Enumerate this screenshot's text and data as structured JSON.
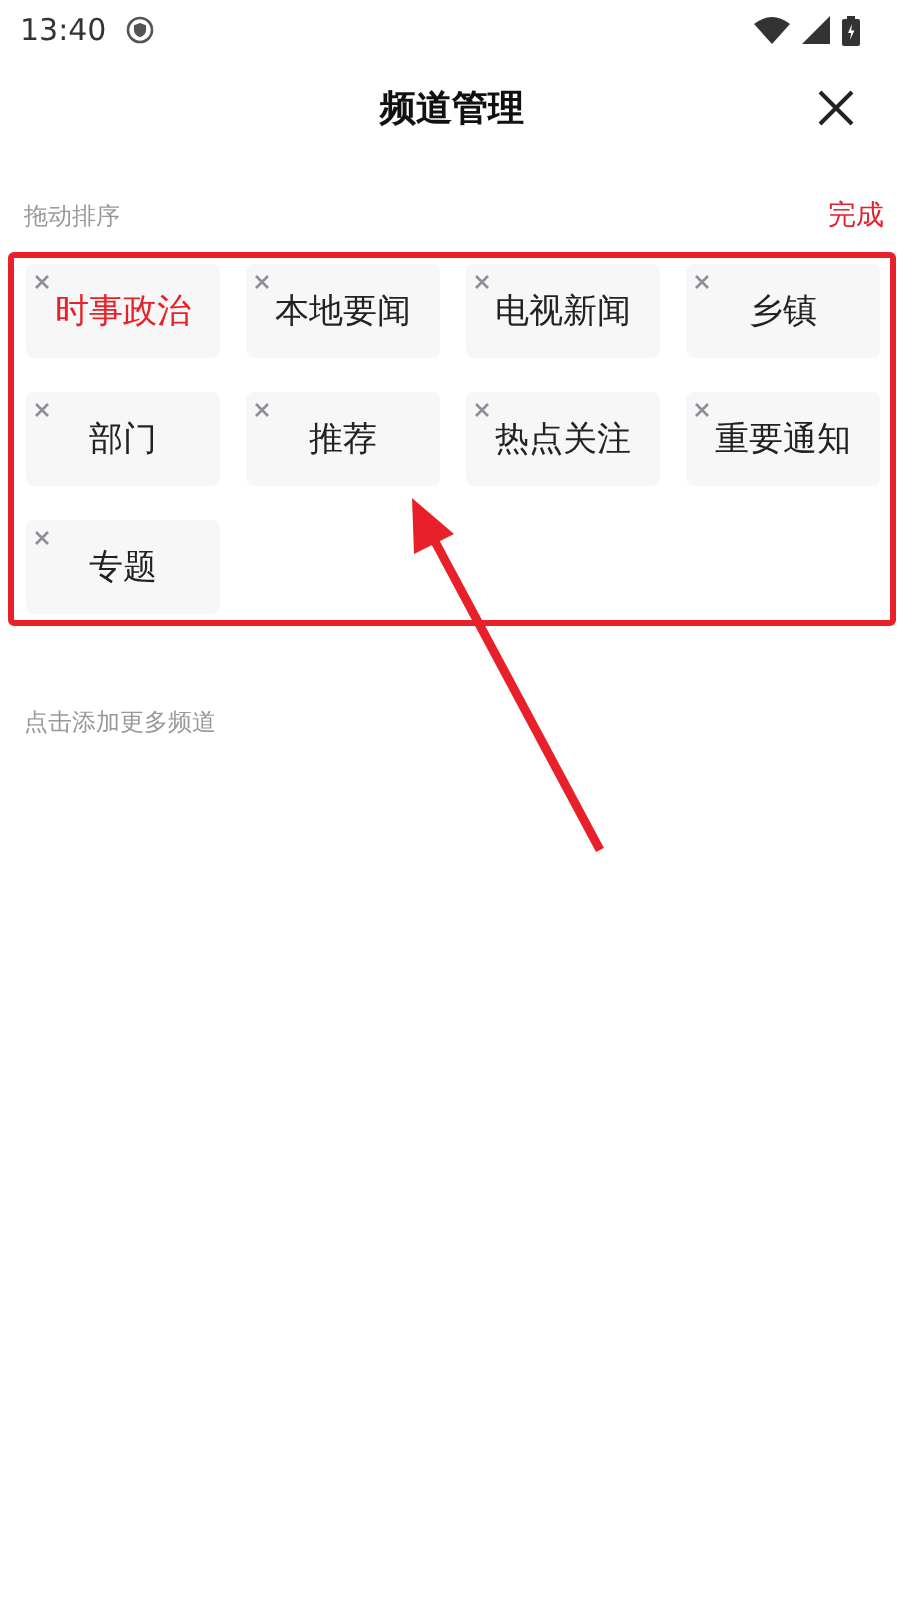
{
  "status_bar": {
    "time": "13:40"
  },
  "header": {
    "title": "频道管理"
  },
  "my_channels": {
    "label": "拖动排序",
    "action": "完成",
    "channels": [
      {
        "name": "时事政治",
        "selected": true
      },
      {
        "name": "本地要闻",
        "selected": false
      },
      {
        "name": "电视新闻",
        "selected": false
      },
      {
        "name": "乡镇",
        "selected": false
      },
      {
        "name": "部门",
        "selected": false
      },
      {
        "name": "推荐",
        "selected": false
      },
      {
        "name": "热点关注",
        "selected": false
      },
      {
        "name": "重要通知",
        "selected": false
      },
      {
        "name": "专题",
        "selected": false
      }
    ]
  },
  "more_channels": {
    "label": "点击添加更多频道"
  }
}
